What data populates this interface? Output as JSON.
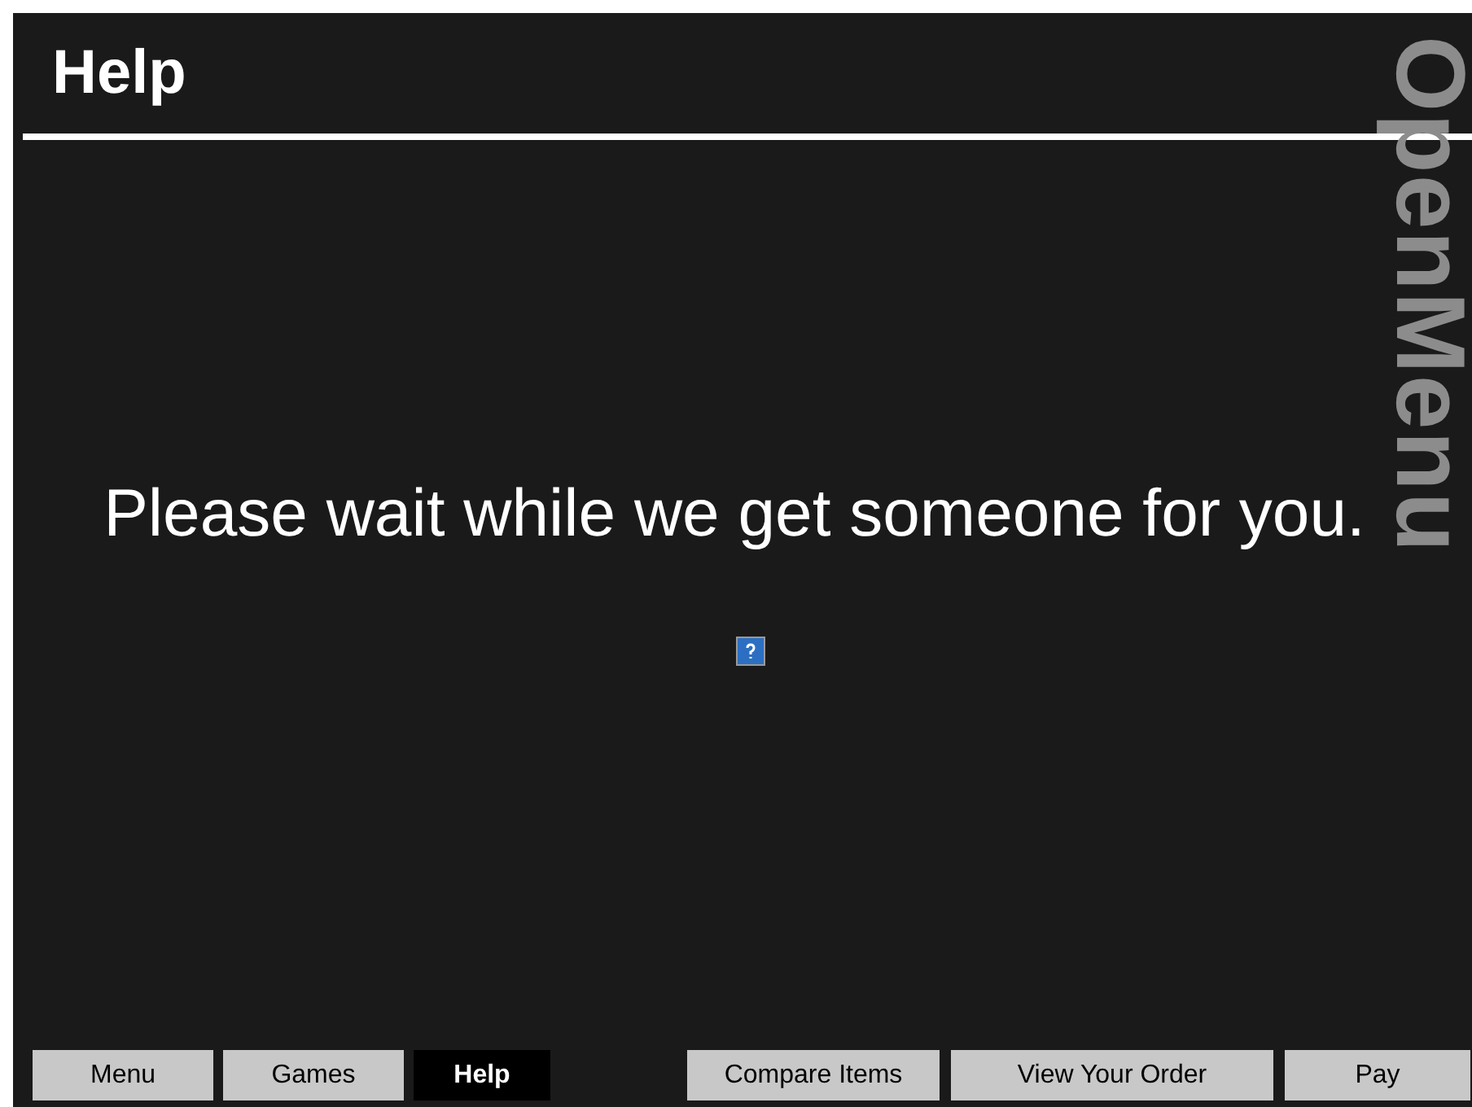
{
  "header": {
    "title": "Help"
  },
  "brand": "OpenMenu",
  "message": "Please wait while we get someone for you.",
  "nav_left": [
    {
      "label": "Menu",
      "selected": false
    },
    {
      "label": "Games",
      "selected": false
    },
    {
      "label": "Help",
      "selected": true
    }
  ],
  "nav_right": [
    {
      "label": "Compare Items",
      "selected": false
    },
    {
      "label": "View Your Order",
      "selected": false
    },
    {
      "label": "Pay",
      "selected": false
    }
  ]
}
